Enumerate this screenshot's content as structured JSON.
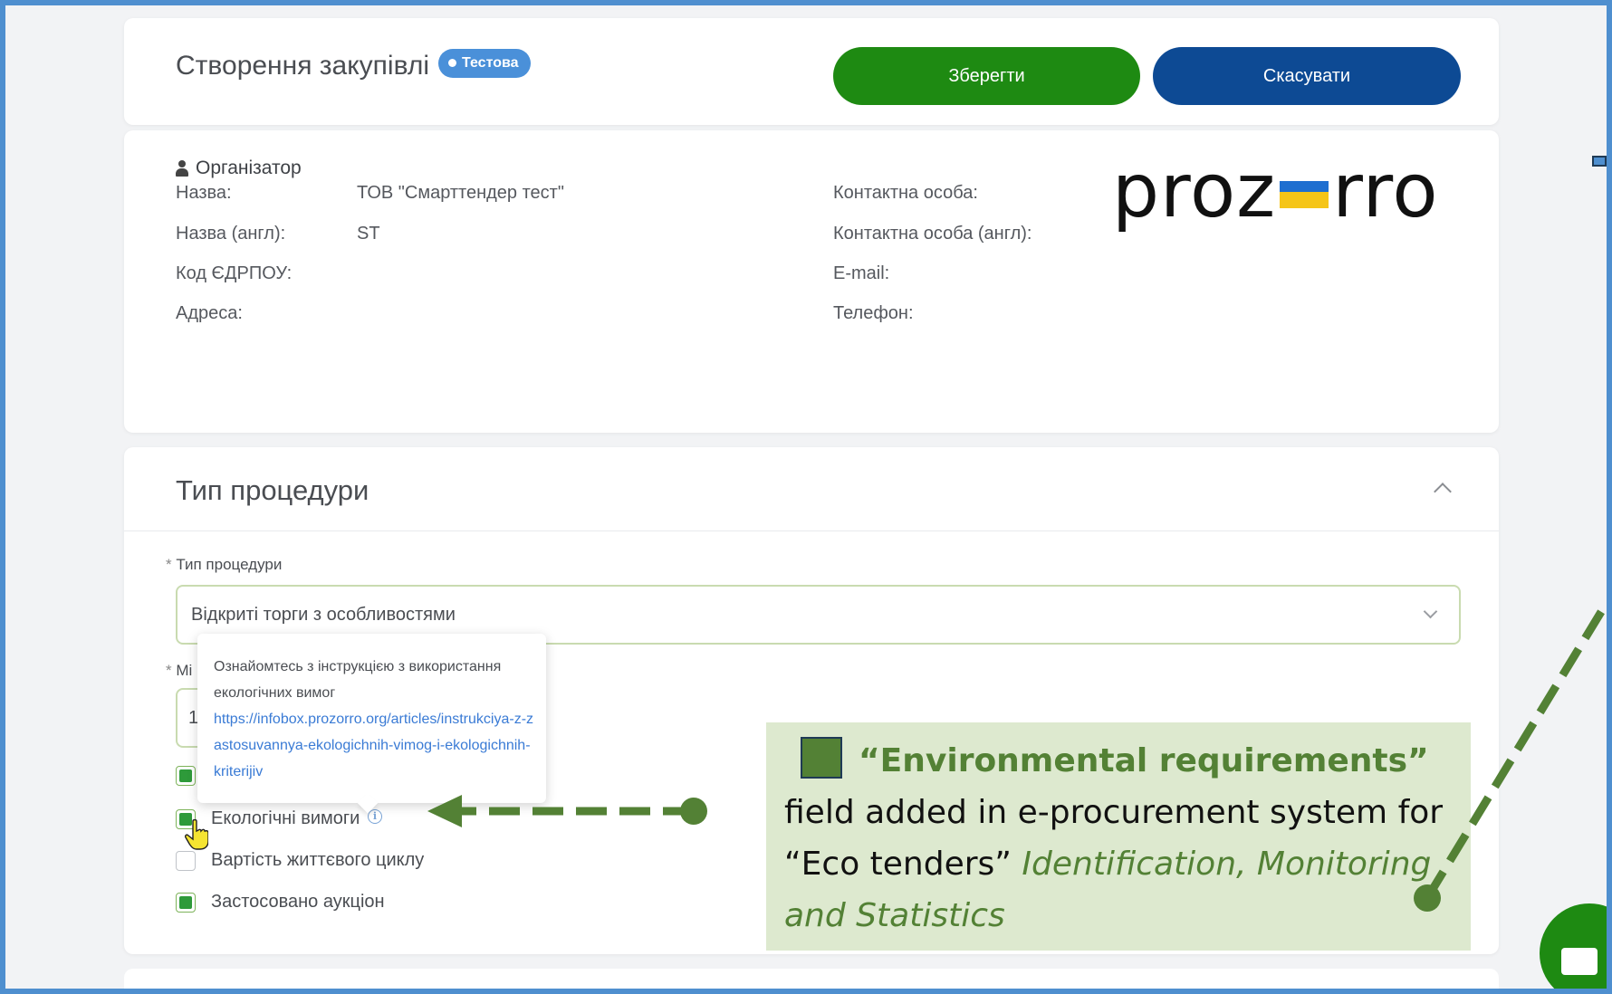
{
  "header": {
    "title": "Створення закупівлі",
    "badge": "Тестова",
    "save_label": "Зберегти",
    "cancel_label": "Скасувати"
  },
  "organizer": {
    "section_title": "Організатор",
    "fields_left": [
      {
        "label": "Назва:",
        "value": "ТОВ \"Смарттендер тест\""
      },
      {
        "label": "Назва (англ):",
        "value": "ST"
      },
      {
        "label": "Код ЄДРПОУ:",
        "value": ""
      },
      {
        "label": "Адреса:",
        "value": ""
      }
    ],
    "fields_right": [
      {
        "label": "Контактна особа:"
      },
      {
        "label": "Контактна особа (англ):"
      },
      {
        "label": "E-mail:"
      },
      {
        "label": "Телефон:"
      }
    ]
  },
  "logo": {
    "left": "proz",
    "right": "rro",
    "flag_colors": [
      "#1f6fd0",
      "#f5c518"
    ]
  },
  "procedure": {
    "section_title": "Тип процедури",
    "type_label": "Тип процедури",
    "type_value": "Відкриті торги з особливостями",
    "second_label_partial": "Мі",
    "second_field_partial": "1",
    "checkboxes": [
      {
        "label": "Екологічні вимоги",
        "checked": true
      },
      {
        "label": "Вартість життєвого циклу",
        "checked": false
      },
      {
        "label": "Застосовано аукціон",
        "checked": true
      }
    ]
  },
  "tooltip": {
    "text": "Ознайомтесь з інструкцією з використання екологічних вимог",
    "link": "https://infobox.prozorro.org/articles/instrukciya-z-zastosuvannya-ekologichnih-vimog-i-ekologichnih-kriterijiv"
  },
  "annotation": {
    "highlight": "“Environmental requirements”",
    "text": " field added in e-procurement system for “Eco tenders” ",
    "italic": "Identification, Monitoring and Statistics"
  },
  "colors": {
    "save": "#1e8a12",
    "cancel": "#0d4a94",
    "annotation_bg": "#dde9cf",
    "annotation_accent": "#538135"
  }
}
